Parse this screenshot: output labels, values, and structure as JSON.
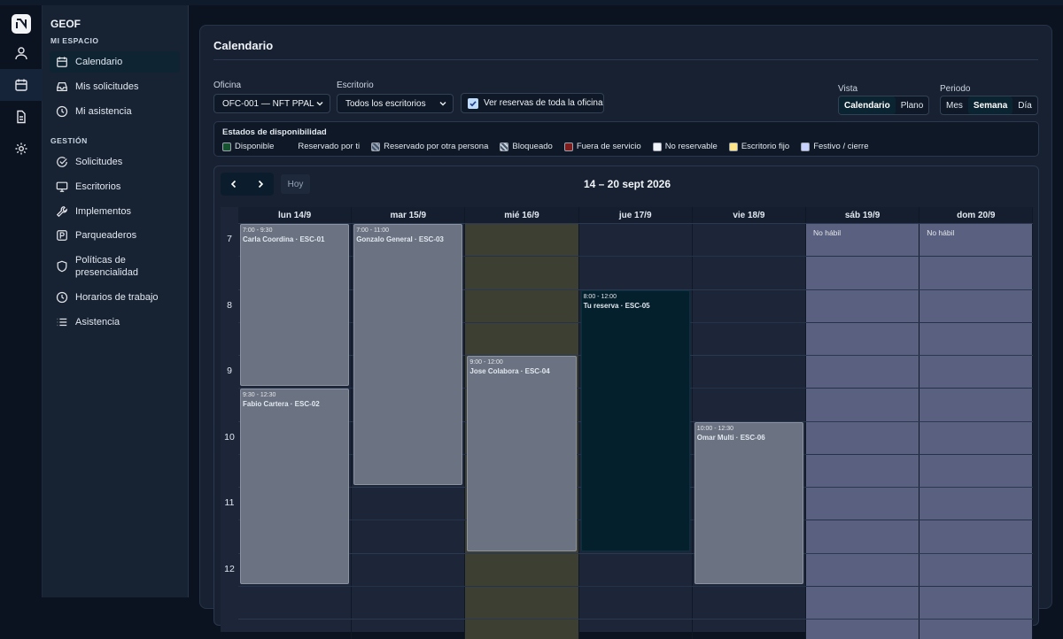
{
  "rail": {
    "icons": [
      "app-logo-icon",
      "user-icon",
      "calendar-icon",
      "document-icon",
      "gear-icon"
    ]
  },
  "sidebar": {
    "title": "GEOF",
    "section1": "MI ESPACIO",
    "section2": "GESTIÓN",
    "items1": [
      {
        "label": "Calendario",
        "icon": "calendar-icon"
      },
      {
        "label": "Mis solicitudes",
        "icon": "inbox-icon"
      },
      {
        "label": "Mi asistencia",
        "icon": "clock-icon"
      }
    ],
    "items2": [
      {
        "label": "Solicitudes",
        "icon": "check-circle-icon"
      },
      {
        "label": "Escritorios",
        "icon": "monitor-icon"
      },
      {
        "label": "Implementos",
        "icon": "wrench-icon"
      },
      {
        "label": "Parqueaderos",
        "icon": "parking-icon"
      },
      {
        "label": "Políticas de presencialidad",
        "icon": "shield-icon"
      },
      {
        "label": "Horarios de trabajo",
        "icon": "clock-icon"
      },
      {
        "label": "Asistencia",
        "icon": "list-icon"
      }
    ]
  },
  "main": {
    "title": "Calendario",
    "filters": {
      "office_label": "Oficina",
      "office_value": "OFC-001 — NFT PPAL",
      "desk_label": "Escritorio",
      "desk_value": "Todos los escritorios",
      "whole_office_label": "Ver reservas de toda la oficina",
      "whole_office_checked": true
    },
    "view": {
      "label": "Vista",
      "options": [
        "Calendario",
        "Plano"
      ],
      "selected": "Calendario"
    },
    "period": {
      "label": "Periodo",
      "options": [
        "Mes",
        "Semana",
        "Día"
      ],
      "selected": "Semana"
    },
    "legend": {
      "title": "Estados de disponibilidad",
      "items": [
        {
          "label": "Disponible",
          "color": "#14532d"
        },
        {
          "label": "Reservado por ti",
          "color": "#0f1826"
        },
        {
          "label": "Reservado por otra persona",
          "color": "#94a3b8"
        },
        {
          "label": "Bloqueado",
          "color": "#cbd5e1"
        },
        {
          "label": "Fuera de servicio",
          "color": "#7f1d1d"
        },
        {
          "label": "No reservable",
          "color": "#f1f5f9"
        },
        {
          "label": "Escritorio fijo",
          "color": "#fde68a"
        },
        {
          "label": "Festivo / cierre",
          "color": "#c7d2fe"
        }
      ]
    },
    "calendar": {
      "today_label": "Hoy",
      "range": "14 – 20 sept 2026",
      "days": [
        "lun 14/9",
        "mar 15/9",
        "mié 16/9",
        "jue 17/9",
        "vie 18/9",
        "sáb 19/9",
        "dom 20/9"
      ],
      "hours": [
        "7",
        "8",
        "9",
        "10",
        "11",
        "12"
      ],
      "no_habil": "No hábil",
      "events": [
        {
          "day": 0,
          "start": 7.0,
          "end": 9.5,
          "time": "7:00 - 9:30",
          "name": "Carla Coordina · ESC-01",
          "kind": "other"
        },
        {
          "day": 0,
          "start": 9.5,
          "end": 12.5,
          "time": "9:30 - 12:30",
          "name": "Fabio Cartera · ESC-02",
          "kind": "other"
        },
        {
          "day": 1,
          "start": 7.0,
          "end": 11.0,
          "time": "7:00 - 11:00",
          "name": "Gonzalo General · ESC-03",
          "kind": "other"
        },
        {
          "day": 2,
          "start": 9.0,
          "end": 12.0,
          "time": "9:00 - 12:00",
          "name": "Jose Colabora · ESC-04",
          "kind": "other"
        },
        {
          "day": 3,
          "start": 8.0,
          "end": 12.0,
          "time": "8:00 - 12:00",
          "name": "Tu reserva · ESC-05",
          "kind": "mine"
        },
        {
          "day": 4,
          "start": 10.0,
          "end": 12.5,
          "time": "10:00 - 12:30",
          "name": "Omar Multi · ESC-06",
          "kind": "other"
        }
      ],
      "colors": {
        "other": "#6b7281",
        "mine": "#04202c",
        "fixed_day": "#3d3f33",
        "holiday": "#5a6180"
      }
    }
  }
}
